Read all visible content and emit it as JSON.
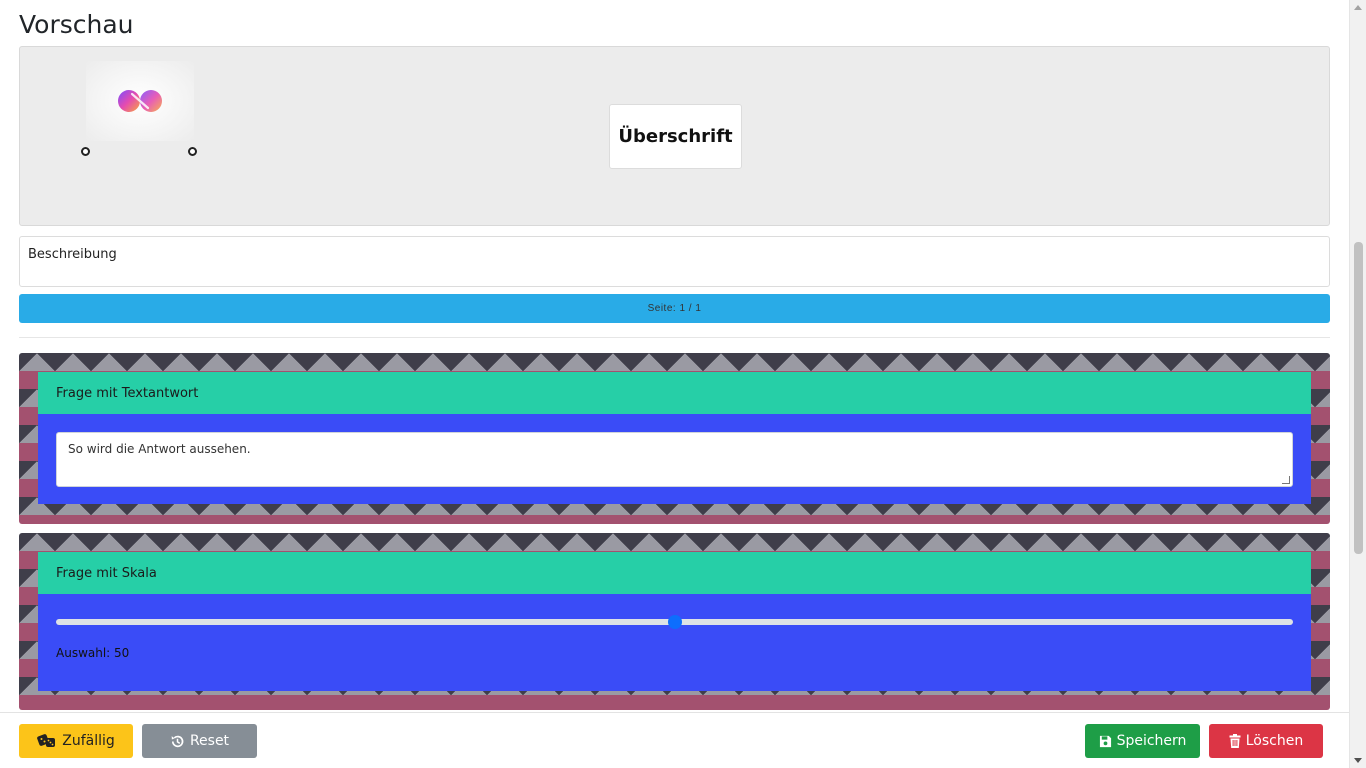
{
  "preview": {
    "title": "Vorschau",
    "heading": "Überschrift",
    "description": "Beschreibung",
    "page_indicator": "Seite: 1 / 1"
  },
  "questions": [
    {
      "label": "Frage mit Textantwort",
      "answer_text": "So wird die Antwort aussehen."
    },
    {
      "label": "Frage mit Skala",
      "slider_value_fraction": 0.5,
      "selection_text": "Auswahl: 50"
    }
  ],
  "footer": {
    "random_label": "Zufällig",
    "reset_label": "Reset",
    "save_label": "Speichern",
    "delete_label": "Löschen"
  },
  "colors": {
    "page_bar": "#29abe7",
    "card_header": "#26cfa7",
    "card_body": "#3a4cf7",
    "random_button": "#fcc419",
    "reset_button": "#868e96",
    "save_button": "#1e9e47",
    "delete_button": "#dc3545"
  },
  "icons": {
    "logo": "infinity-logo-icon",
    "random": "dice-icon",
    "reset": "history-icon",
    "save": "floppy-disk-icon",
    "delete": "trash-icon"
  }
}
